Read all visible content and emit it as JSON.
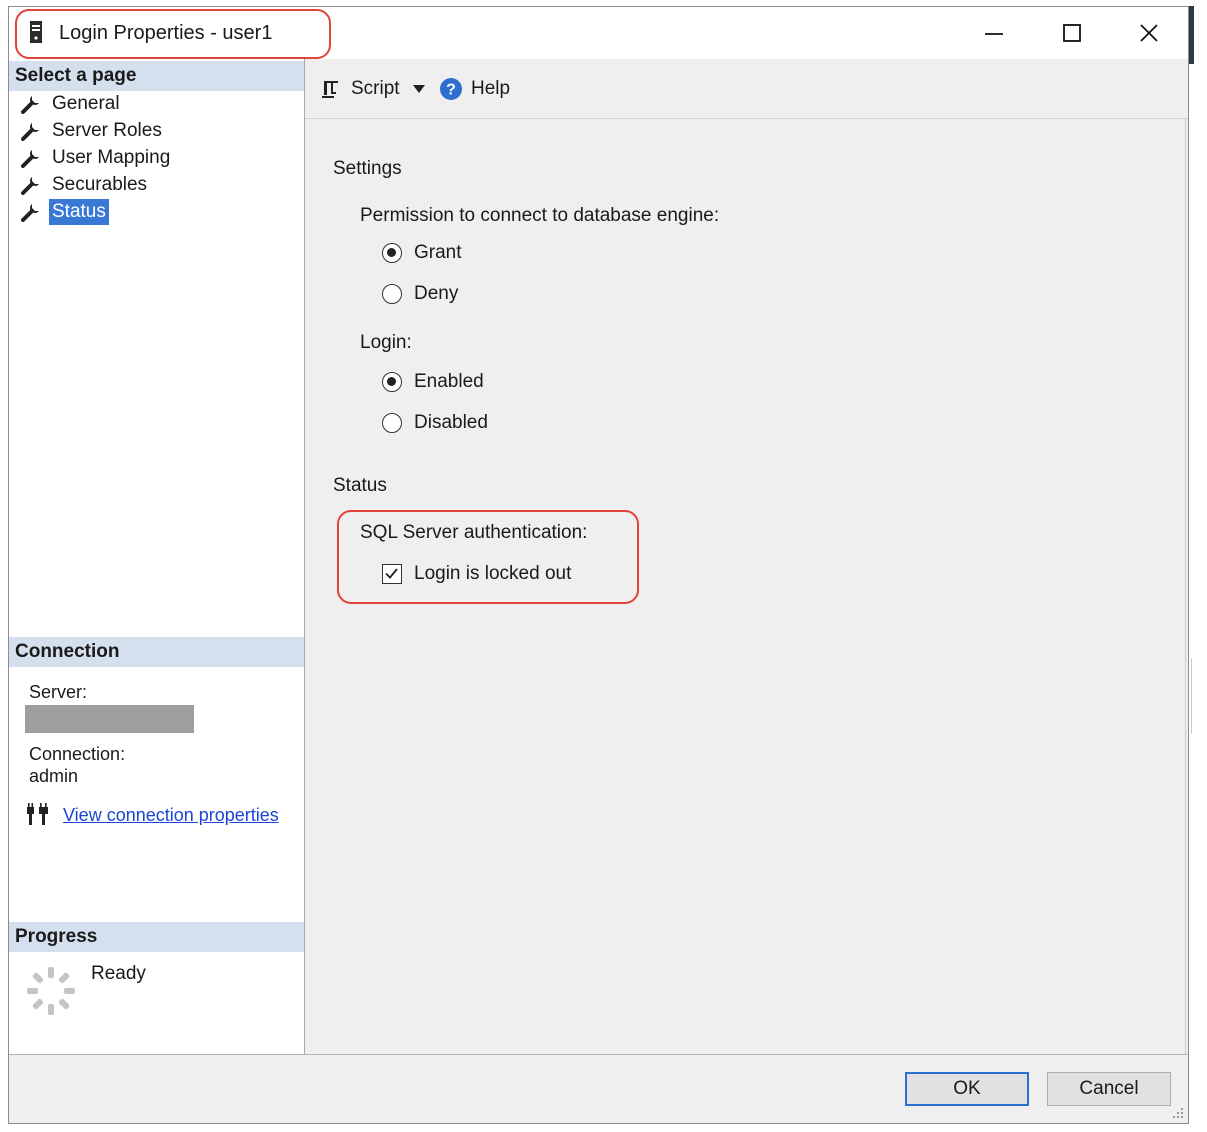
{
  "window": {
    "title": "Login Properties - user1",
    "controls": {
      "minimize": "minimize-icon",
      "maximize": "maximize-icon",
      "close": "close-icon"
    }
  },
  "sidebar": {
    "header": "Select a page",
    "items": [
      {
        "label": "General",
        "icon": "wrench-icon",
        "active": false
      },
      {
        "label": "Server Roles",
        "icon": "wrench-icon",
        "active": false
      },
      {
        "label": "User Mapping",
        "icon": "wrench-icon",
        "active": false
      },
      {
        "label": "Securables",
        "icon": "wrench-icon",
        "active": false
      },
      {
        "label": "Status",
        "icon": "wrench-icon",
        "active": true
      }
    ]
  },
  "connection": {
    "header": "Connection",
    "server_label": "Server:",
    "server_value": "",
    "connection_label": "Connection:",
    "connection_value": "admin",
    "link": "View connection properties"
  },
  "progress": {
    "header": "Progress",
    "status": "Ready"
  },
  "toolbar": {
    "script_label": "Script",
    "help_label": "Help"
  },
  "settings": {
    "heading": "Settings",
    "permission_label": "Permission to connect to database engine:",
    "permission_options": [
      {
        "label": "Grant",
        "checked": true
      },
      {
        "label": "Deny",
        "checked": false
      }
    ],
    "login_label": "Login:",
    "login_options": [
      {
        "label": "Enabled",
        "checked": true
      },
      {
        "label": "Disabled",
        "checked": false
      }
    ]
  },
  "status": {
    "heading": "Status",
    "auth_label": "SQL Server authentication:",
    "locked_out_label": "Login is locked out",
    "locked_out_checked": true
  },
  "footer": {
    "ok_label": "OK",
    "cancel_label": "Cancel"
  },
  "colors": {
    "accent": "#3a78d6",
    "highlight": "#e0443a",
    "header_bg": "#d5e0ee",
    "link": "#1a45d8"
  }
}
